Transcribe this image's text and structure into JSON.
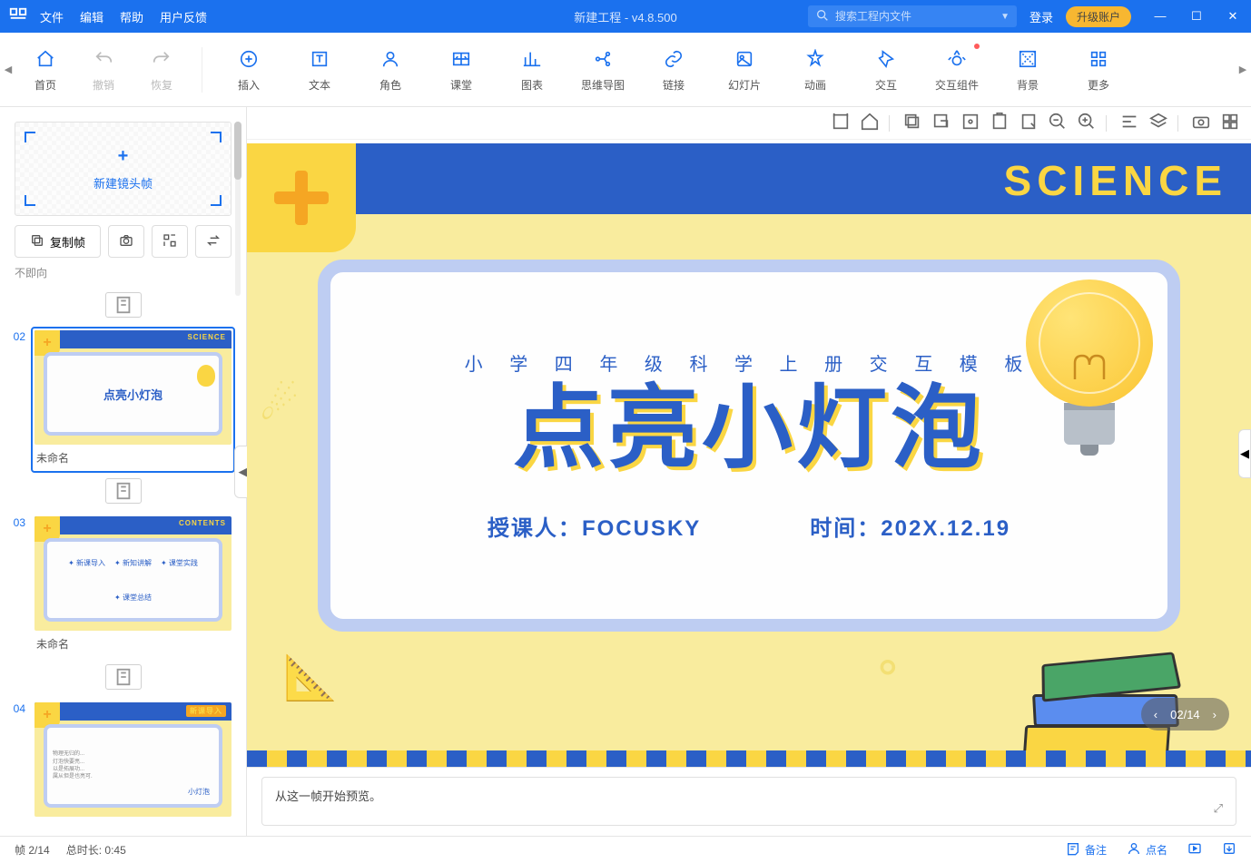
{
  "titlebar": {
    "menu": [
      "文件",
      "编辑",
      "帮助",
      "用户反馈"
    ],
    "title": "新建工程 - v4.8.500",
    "search_placeholder": "搜索工程内文件",
    "login": "登录",
    "upgrade": "升级账户"
  },
  "toolbar": {
    "items": [
      {
        "id": "home",
        "label": "首页"
      },
      {
        "id": "undo",
        "label": "撤销",
        "disabled": true
      },
      {
        "id": "redo",
        "label": "恢复",
        "disabled": true
      },
      {
        "id": "sep"
      },
      {
        "id": "insert",
        "label": "插入"
      },
      {
        "id": "text",
        "label": "文本"
      },
      {
        "id": "role",
        "label": "角色"
      },
      {
        "id": "class",
        "label": "课堂"
      },
      {
        "id": "chart",
        "label": "图表"
      },
      {
        "id": "mindmap",
        "label": "思维导图"
      },
      {
        "id": "link",
        "label": "链接"
      },
      {
        "id": "slide",
        "label": "幻灯片"
      },
      {
        "id": "anim",
        "label": "动画"
      },
      {
        "id": "interact",
        "label": "交互"
      },
      {
        "id": "widget",
        "label": "交互组件",
        "dot": true
      },
      {
        "id": "bg",
        "label": "背景"
      },
      {
        "id": "more",
        "label": "更多"
      }
    ]
  },
  "left": {
    "new_frame": "新建镜头帧",
    "copy_frame": "复制帧",
    "truncated": "不即向",
    "thumbs": [
      {
        "num": "02",
        "caption": "未命名",
        "label": "SCIENCE",
        "title": "点亮小灯泡",
        "selected": true
      },
      {
        "num": "03",
        "caption": "未命名",
        "label": "CONTENTS",
        "title": "",
        "selected": false,
        "contents": [
          "新课导入",
          "新知讲解",
          "课堂实践",
          "课堂总结"
        ]
      },
      {
        "num": "04",
        "caption": "",
        "label": "新课导入",
        "title": "",
        "selected": false
      }
    ]
  },
  "slide": {
    "science": "SCIENCE",
    "subtitle": "小 学 四 年 级 科 学 上 册 交 互 模 板",
    "title": "点亮小灯泡",
    "teacher_label": "授课人：",
    "teacher": "FOCUSKY",
    "time_label": "时间：",
    "time": "202X.12.19",
    "nav": {
      "current": "02",
      "total": "14"
    }
  },
  "preview": {
    "text": "从这一帧开始预览。"
  },
  "status": {
    "frame": "帧 2/14",
    "duration_label": "总时长:",
    "duration": "0:45",
    "notes": "备注",
    "roll": "点名"
  }
}
